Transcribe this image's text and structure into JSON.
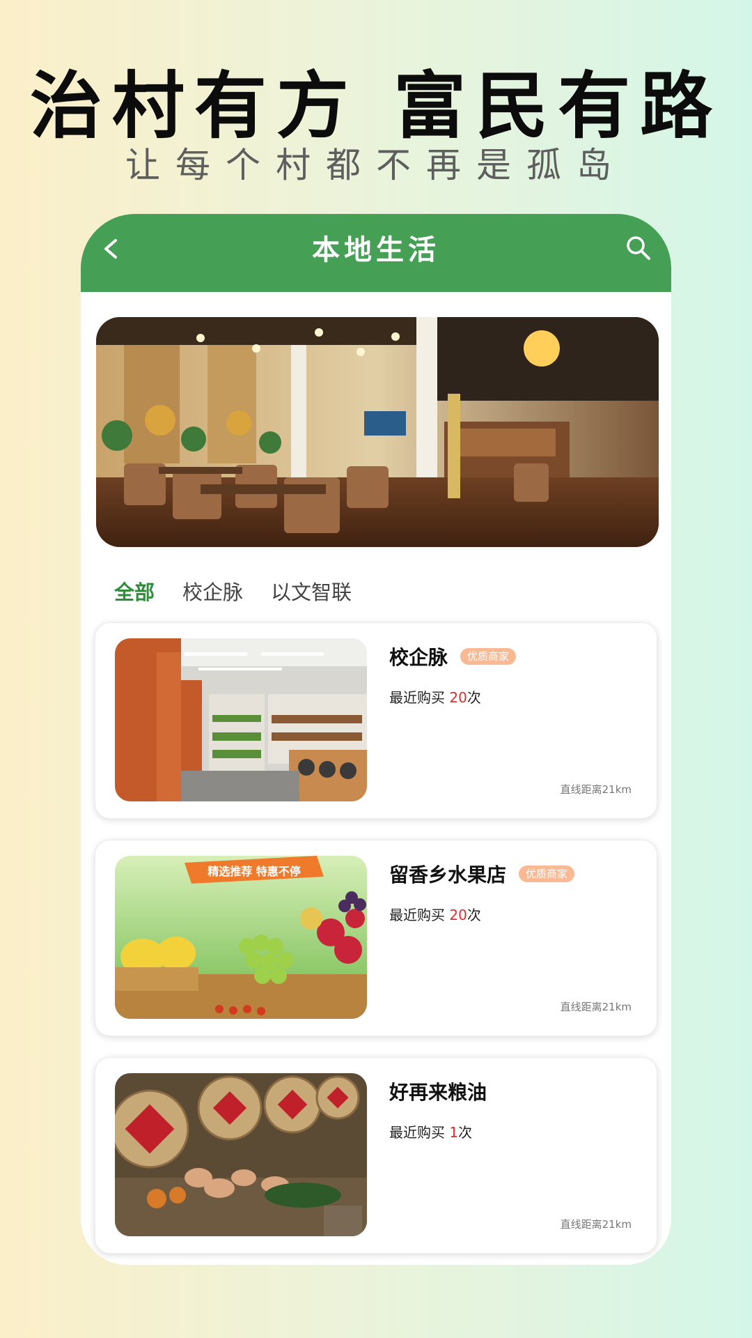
{
  "headline": "治村有方 富民有路",
  "subline": "让每个村都不再是孤岛",
  "topbar": {
    "title": "本地生活",
    "back_icon": "chevron-left-icon",
    "search_icon": "search-icon"
  },
  "tabs": [
    {
      "label": "全部",
      "active": true
    },
    {
      "label": "校企脉",
      "active": false
    },
    {
      "label": "以文智联",
      "active": false
    }
  ],
  "shops": [
    {
      "name": "校企脉",
      "badge": "优质商家",
      "sales_prefix": "最近购买 ",
      "sales_count": "20",
      "sales_suffix": "次",
      "distance": "直线距离21km"
    },
    {
      "name": "留香乡水果店",
      "badge": "优质商家",
      "sales_prefix": "最近购买 ",
      "sales_count": "20",
      "sales_suffix": "次",
      "distance": "直线距离21km"
    },
    {
      "name": "好再来粮油",
      "badge": "",
      "sales_prefix": "最近购买 ",
      "sales_count": "1",
      "sales_suffix": "次",
      "distance": "直线距离21km"
    }
  ],
  "promo_banner": "精选推荐 特惠不停",
  "colors": {
    "brand_green": "#45a056",
    "tab_active": "#2f8d3c",
    "badge": "#f8b993",
    "count_red": "#e42b2b"
  }
}
